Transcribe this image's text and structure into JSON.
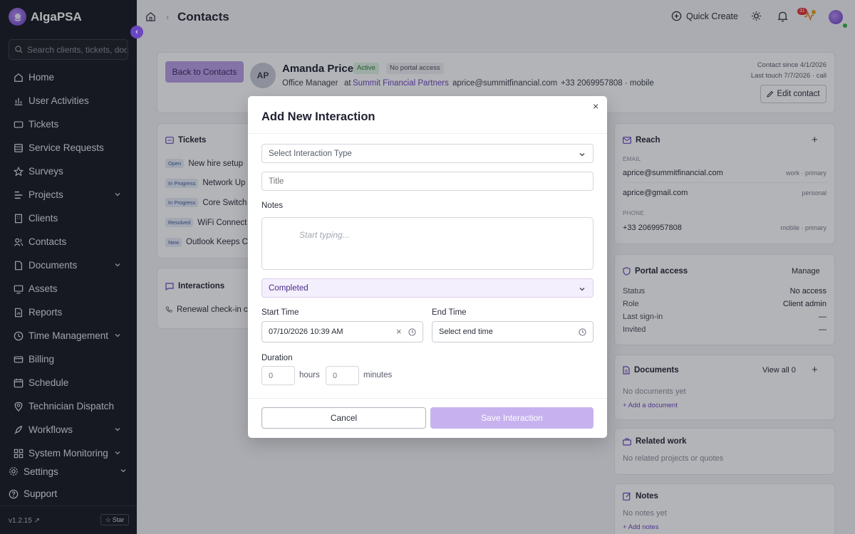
{
  "app": {
    "name": "AlgaPSA",
    "version": "v1.2.15",
    "star_label": "Star"
  },
  "colors": {
    "accent": "#6b46c1",
    "sidebar_bg": "#191b22",
    "save_disabled": "#c7b2ef"
  },
  "search": {
    "placeholder": "Search clients, tickets, doc"
  },
  "sidebar": {
    "items": [
      {
        "label": "Home",
        "icon": "home-icon"
      },
      {
        "label": "User Activities",
        "icon": "bar-chart-icon"
      },
      {
        "label": "Tickets",
        "icon": "ticket-icon"
      },
      {
        "label": "Service Requests",
        "icon": "request-icon"
      },
      {
        "label": "Surveys",
        "icon": "star-icon"
      },
      {
        "label": "Projects",
        "icon": "projects-icon"
      },
      {
        "label": "Clients",
        "icon": "building-icon"
      },
      {
        "label": "Contacts",
        "icon": "contacts-icon"
      },
      {
        "label": "Documents",
        "icon": "document-icon"
      },
      {
        "label": "Assets",
        "icon": "monitor-icon"
      },
      {
        "label": "Reports",
        "icon": "report-icon"
      },
      {
        "label": "Time Management",
        "icon": "clock-icon"
      },
      {
        "label": "Billing",
        "icon": "billing-icon"
      },
      {
        "label": "Schedule",
        "icon": "calendar-icon"
      },
      {
        "label": "Technician Dispatch",
        "icon": "map-pin-icon"
      },
      {
        "label": "Workflows",
        "icon": "rocket-icon"
      },
      {
        "label": "System Monitoring",
        "icon": "grid-icon"
      }
    ],
    "settings_label": "Settings",
    "support_label": "Support"
  },
  "header": {
    "title": "Contacts",
    "quick_create": "Quick Create",
    "notification_count": "31"
  },
  "contact": {
    "back_label": "Back to Contacts",
    "initials": "AP",
    "name": "Amanda Price",
    "status": "Active",
    "portal": "No portal access",
    "role": "Office Manager",
    "at": "at",
    "company": "Summit Financial Partners",
    "email": "aprice@summitfinancial.com",
    "phone": "+33 2069957808 · mobile",
    "since": "Contact since 4/1/2026",
    "last_touch": "Last touch 7/7/2026 · call",
    "edit_label": "Edit contact"
  },
  "tickets": {
    "title": "Tickets",
    "rows": [
      {
        "status": "Open",
        "title": "New hire setup"
      },
      {
        "status": "In Progress",
        "title": "Network Up"
      },
      {
        "status": "In Progress",
        "title": "Core Switch"
      },
      {
        "status": "Resolved",
        "title": "WiFi Connect"
      },
      {
        "status": "New",
        "title": "Outlook Keeps C"
      }
    ]
  },
  "interactions": {
    "title": "Interactions",
    "row": "Renewal check-in ca"
  },
  "reach": {
    "title": "Reach",
    "email_label": "EMAIL",
    "emails": [
      {
        "value": "aprice@summitfinancial.com",
        "hint": "work · primary"
      },
      {
        "value": "aprice@gmail.com",
        "hint": "personal"
      }
    ],
    "phone_label": "PHONE",
    "phone": {
      "value": "+33 2069957808",
      "hint": "mobile · primary"
    }
  },
  "portal_access": {
    "title": "Portal access",
    "manage": "Manage",
    "rows": [
      {
        "label": "Status",
        "value": "No access"
      },
      {
        "label": "Role",
        "value": "Client admin"
      },
      {
        "label": "Last sign-in",
        "value": "—"
      },
      {
        "label": "Invited",
        "value": "—"
      }
    ]
  },
  "documents": {
    "title": "Documents",
    "view_all": "View all 0",
    "empty": "No documents yet",
    "add": "Add a document"
  },
  "related": {
    "title": "Related work",
    "empty": "No related projects or quotes"
  },
  "notes": {
    "title": "Notes",
    "empty": "No notes yet",
    "add": "Add notes"
  },
  "modal": {
    "title": "Add New Interaction",
    "type_placeholder": "Select Interaction Type",
    "title_placeholder": "Title",
    "notes_label": "Notes",
    "notes_placeholder": "Start typing...",
    "status_value": "Completed",
    "start_label": "Start Time",
    "start_value": "07/10/2026 10:39 AM",
    "end_label": "End Time",
    "end_placeholder": "Select end time",
    "duration_label": "Duration",
    "hours_placeholder": "0",
    "hours_unit": "hours",
    "minutes_placeholder": "0",
    "minutes_unit": "minutes",
    "cancel": "Cancel",
    "save": "Save Interaction"
  }
}
